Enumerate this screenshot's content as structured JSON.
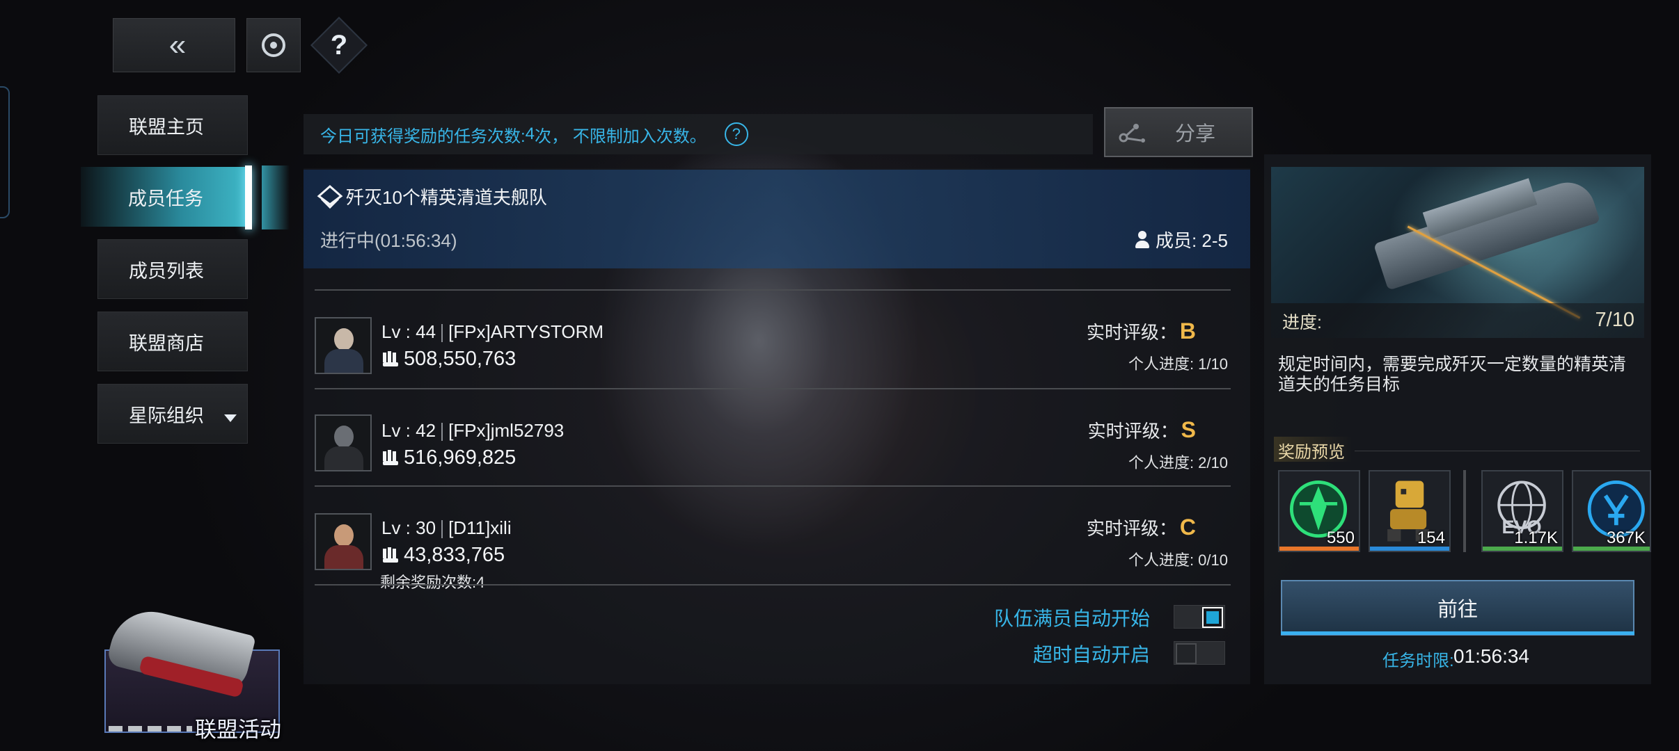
{
  "top_bar": {
    "back_label": "«",
    "help_label": "?"
  },
  "nav": {
    "items": [
      {
        "label": "联盟主页"
      },
      {
        "label": "成员任务",
        "active": true
      },
      {
        "label": "成员列表"
      },
      {
        "label": "联盟商店"
      },
      {
        "label": "星际组织"
      }
    ]
  },
  "info_bar": {
    "text_prefix": "今日可获得奖励的任务次数: ",
    "count": "4",
    "text_suffix": "次， 不限制加入次数。",
    "help_label": "?"
  },
  "share": {
    "label": "分享"
  },
  "task": {
    "title": "歼灭10个精英清道夫舰队",
    "status": "进行中(01:56:34)",
    "members": "成员: 2-5"
  },
  "members": [
    {
      "level": "Lv : 44",
      "name": "[FPx]ARTYSTORM",
      "power": "508,550,763",
      "rating_label": "实时评级：",
      "grade": "B",
      "progress": "个人进度: 1/10"
    },
    {
      "level": "Lv : 42",
      "name": "[FPx]jml52793",
      "power": "516,969,825",
      "rating_label": "实时评级：",
      "grade": "S",
      "progress": "个人进度: 2/10"
    },
    {
      "level": "Lv : 30",
      "name": "[D11]xili",
      "power": "43,833,765",
      "rating_label": "实时评级：",
      "grade": "C",
      "progress": "个人进度: 0/10",
      "remaining": "剩余奖励次数:4"
    }
  ],
  "auto_options": {
    "full_start": {
      "label": "队伍满员自动开始",
      "enabled": true
    },
    "timeout_start": {
      "label": "超时自动开启",
      "enabled": false
    }
  },
  "details": {
    "progress_label": "进度:",
    "progress_value": "7/10",
    "progress_fraction": 0.7,
    "description": "规定时间内，需要完成歼灭一定数量的精英清道夫的任务目标",
    "reward_title": "奖励预览",
    "rewards": [
      {
        "icon": "green-emblem-icon",
        "count": "550",
        "rarity_color": "#e8762a"
      },
      {
        "icon": "yellow-robot-icon",
        "count": "154",
        "rarity_color": "#2a8ad8"
      },
      {
        "icon": "evo-globe-icon",
        "count": "1.17K",
        "rarity_color": "#4caa4c"
      },
      {
        "icon": "blue-token-icon",
        "count": "367K",
        "rarity_color": "#4caa4c"
      }
    ],
    "go_label": "前往",
    "timer_label": "任务时限:",
    "timer_value": "01:56:34"
  },
  "event": {
    "label": "联盟活动"
  },
  "colors": {
    "accent_blue": "#38b6e8",
    "grade_gold": "#f0b84a",
    "nav_active": "#2a8a9c"
  }
}
